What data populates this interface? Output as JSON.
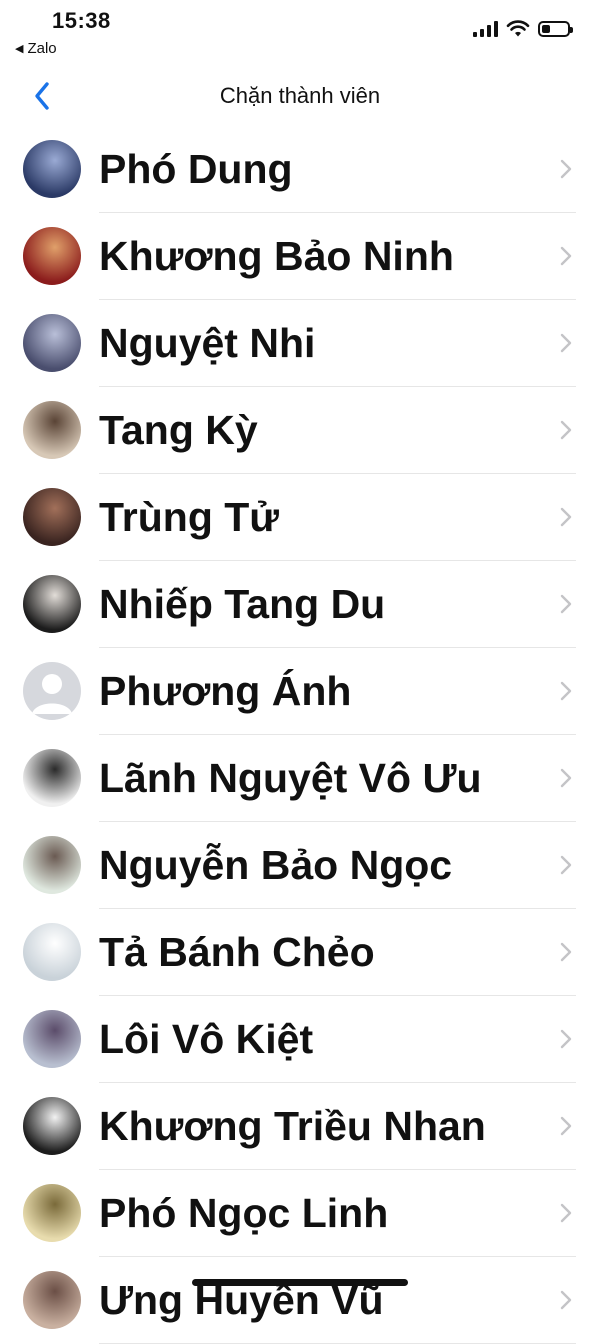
{
  "status": {
    "time": "15:38",
    "back_app": "Zalo"
  },
  "header": {
    "title": "Chặn thành viên"
  },
  "members": [
    {
      "name": "Phó Dung",
      "avatar": "photo-avatar",
      "c1": "#2b3a66",
      "c2": "#9aaad4"
    },
    {
      "name": "Khương Bảo Ninh",
      "avatar": "photo-avatar",
      "c1": "#8b1c1c",
      "c2": "#e0a06a"
    },
    {
      "name": "Nguyệt Nhi",
      "avatar": "photo-avatar",
      "c1": "#4a4e6e",
      "c2": "#b9bfd8"
    },
    {
      "name": "Tang Kỳ",
      "avatar": "photo-avatar",
      "c1": "#d7c8b6",
      "c2": "#5a4436"
    },
    {
      "name": "Trùng Tử",
      "avatar": "photo-avatar",
      "c1": "#3a2420",
      "c2": "#a2705a"
    },
    {
      "name": "Nhiếp Tang Du",
      "avatar": "photo-avatar",
      "c1": "#1c1c1c",
      "c2": "#e2ddd8"
    },
    {
      "name": "Phương Ánh",
      "avatar": "default-person-icon",
      "c1": "#d6d8dd",
      "c2": "#ffffff"
    },
    {
      "name": "Lãnh Nguyệt Vô Ưu",
      "avatar": "photo-avatar",
      "c1": "#f0f0f0",
      "c2": "#2a2a2a"
    },
    {
      "name": "Nguyễn Bảo Ngọc",
      "avatar": "photo-avatar",
      "c1": "#dfe8df",
      "c2": "#6a5a52"
    },
    {
      "name": "Tả Bánh Chẻo",
      "avatar": "photo-avatar",
      "c1": "#c9d2d9",
      "c2": "#ffffff"
    },
    {
      "name": "Lôi Vô Kiệt",
      "avatar": "photo-avatar",
      "c1": "#b8bfd0",
      "c2": "#5b4c6a"
    },
    {
      "name": "Khương Triều Nhan",
      "avatar": "photo-avatar",
      "c1": "#1d1d1d",
      "c2": "#f2f2f2"
    },
    {
      "name": "Phó Ngọc Linh",
      "avatar": "photo-avatar",
      "c1": "#e8dcae",
      "c2": "#7a6a3a"
    },
    {
      "name": "Ưng Huyền Vũ",
      "avatar": "photo-avatar",
      "c1": "#c9b0a0",
      "c2": "#6b4f46"
    }
  ],
  "colors": {
    "accent": "#1a73e8",
    "text": "#111111",
    "chevron": "#c4c4c7",
    "divider": "#e6e6e6"
  }
}
